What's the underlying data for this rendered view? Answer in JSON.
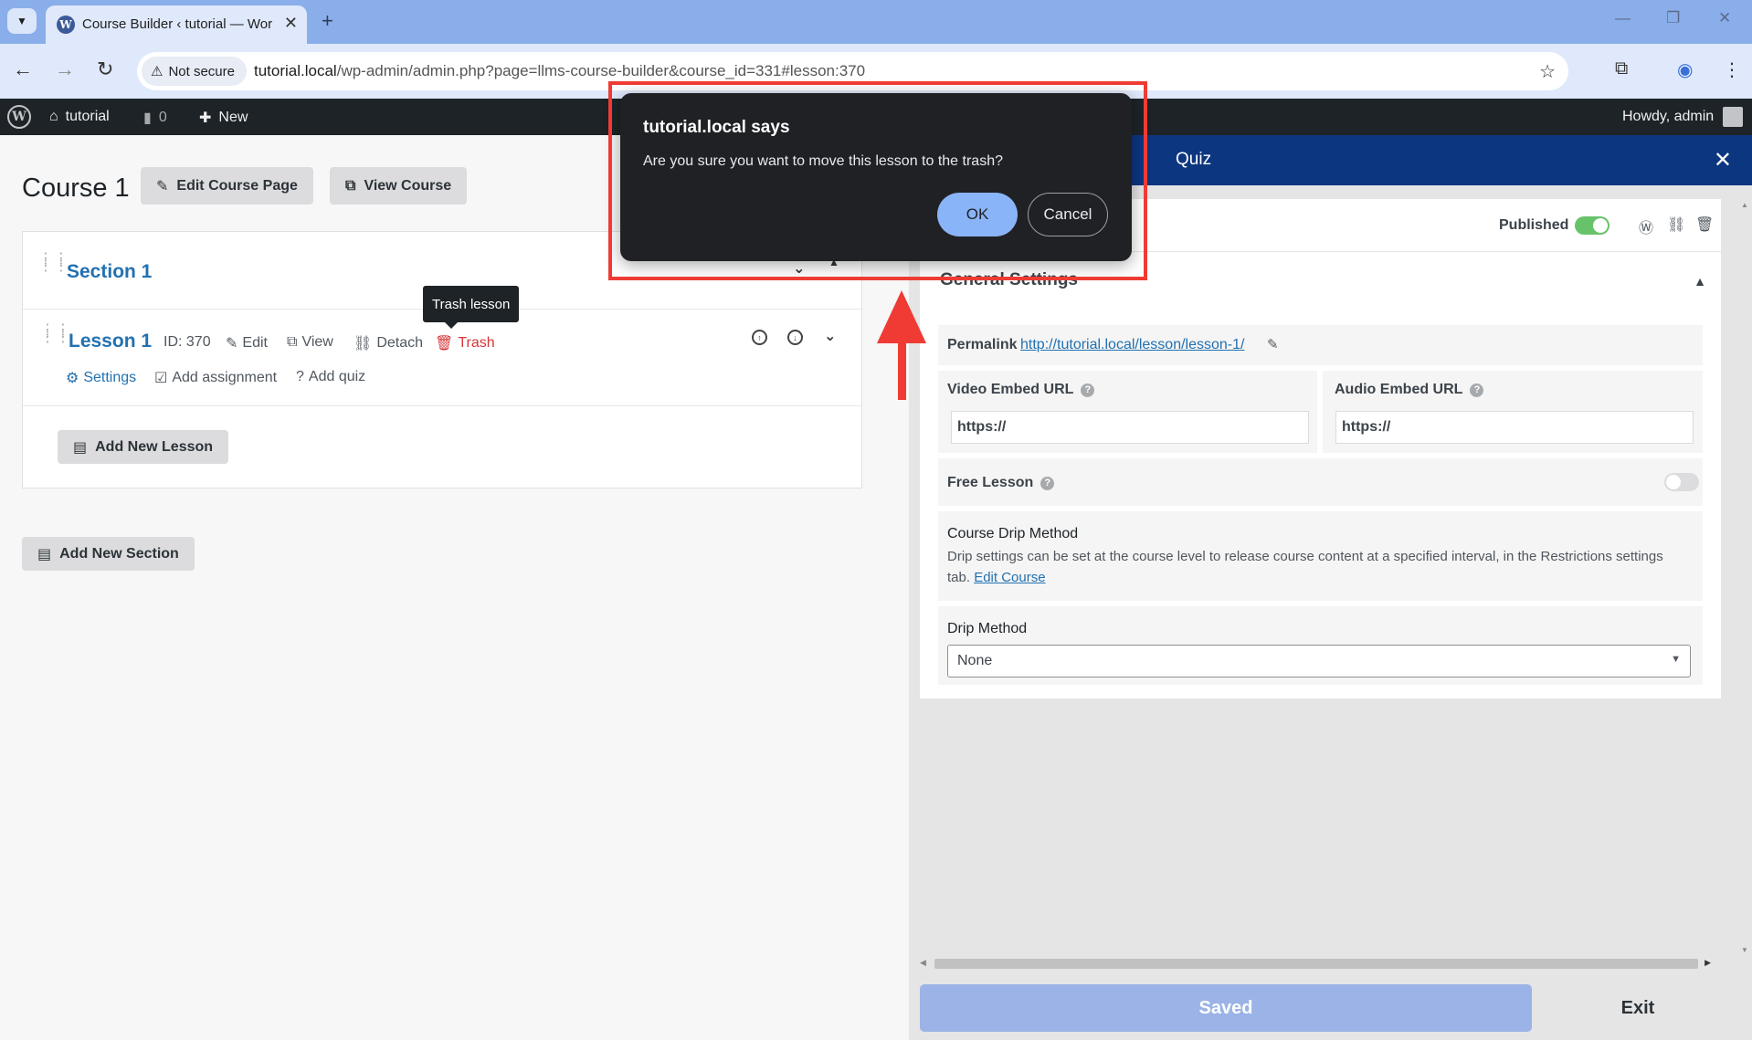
{
  "browser": {
    "tab_title": "Course Builder ‹ tutorial — Wor",
    "tab_close": "✕",
    "new_tab": "+",
    "security_label": "Not secure",
    "url_host": "tutorial.local",
    "url_path": "/wp-admin/admin.php?page=llms-course-builder&course_id=331#lesson:370"
  },
  "adminbar": {
    "site_name": "tutorial",
    "comments_count": "0",
    "new_label": "New",
    "howdy": "Howdy, admin"
  },
  "builder": {
    "course_title": "Course 1",
    "edit_course_page": "Edit Course Page",
    "view_course": "View Course",
    "section_title": "Section 1",
    "lesson": {
      "title": "Lesson 1",
      "id_label": "ID: 370",
      "edit": "Edit",
      "view": "View",
      "detach": "Detach",
      "trash": "Trash",
      "settings": "Settings",
      "add_assignment": "Add assignment",
      "add_quiz": "Add quiz"
    },
    "tooltip": "Trash lesson",
    "add_new_lesson": "Add New Lesson",
    "add_new_section": "Add New Section"
  },
  "panel": {
    "header_quiz": "Quiz",
    "published_label": "Published",
    "published_on": true,
    "general_settings": "General Settings",
    "permalink_label": "Permalink",
    "permalink_url": "http://tutorial.local/lesson/lesson-1/",
    "video_embed_label": "Video Embed URL",
    "video_embed_value": "https://",
    "audio_embed_label": "Audio Embed URL",
    "audio_embed_value": "https://",
    "free_lesson_label": "Free Lesson",
    "free_lesson_on": false,
    "drip_title": "Course Drip Method",
    "drip_desc": "Drip settings can be set at the course level to release course content at a specified interval, in the Restrictions settings tab.",
    "edit_course_link": "Edit Course",
    "drip_method_label": "Drip Method",
    "drip_method_value": "None",
    "saved_button": "Saved",
    "exit_button": "Exit"
  },
  "dialog": {
    "title": "tutorial.local says",
    "message": "Are you sure you want to move this lesson to the trash?",
    "ok": "OK",
    "cancel": "Cancel"
  },
  "colors": {
    "wp_blue": "#2271b1",
    "panel_header": "#0d3680",
    "annotation_red": "#ef3b34",
    "trash_red": "#d63638"
  }
}
